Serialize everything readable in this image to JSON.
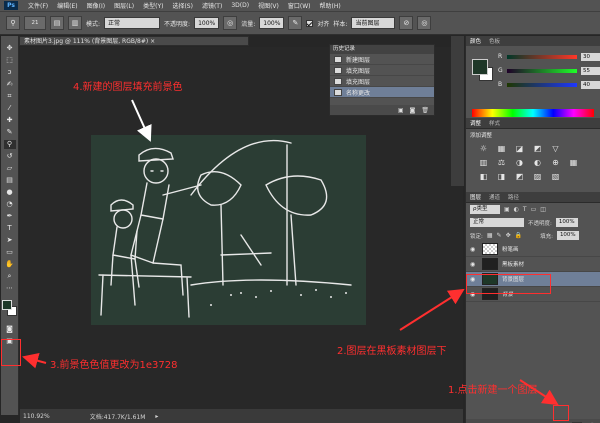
{
  "menubar": {
    "logo": "Ps",
    "items": [
      "文件(F)",
      "编辑(E)",
      "图像(I)",
      "图层(L)",
      "类型(Y)",
      "选择(S)",
      "滤镜(T)",
      "3D(D)",
      "视图(V)",
      "窗口(W)",
      "帮助(H)"
    ]
  },
  "options": {
    "brush_size": "21",
    "mode_label": "模式:",
    "mode_value": "正常",
    "opacity_label": "不透明度:",
    "opacity_value": "100%",
    "flow_label": "流量:",
    "flow_value": "100%",
    "align_label": "对齐",
    "sample_label": "样本:",
    "sample_value": "当前图层"
  },
  "document_tab": "素材图片3.jpg @ 111% (背景图层, RGB/8#) ×",
  "status": {
    "zoom": "110.92%",
    "doc": "文档:417.7K/1.61M"
  },
  "history": {
    "title": "历史记录",
    "items": [
      {
        "label": "新建图层",
        "selected": false
      },
      {
        "label": "填充图层",
        "selected": false
      },
      {
        "label": "填充图层",
        "selected": false
      },
      {
        "label": "名称更改",
        "selected": true
      }
    ]
  },
  "color_panel": {
    "tabs": [
      "颜色",
      "色板"
    ],
    "foreground": "#1e3728",
    "r_label": "R",
    "r_value": "30",
    "g_label": "G",
    "g_value": "55",
    "b_label": "B",
    "b_value": "40"
  },
  "adjust_panel": {
    "tabs": [
      "调整",
      "样式"
    ],
    "title": "添加调整",
    "icons": [
      "☼",
      "▦",
      "◪",
      "◩",
      "▽",
      "",
      "▥",
      "⚖",
      "◑",
      "◐",
      "⊕",
      "▦",
      "◧",
      "◨",
      "◩",
      "▨",
      "▧"
    ]
  },
  "layers_panel": {
    "tabs": [
      "图层",
      "通道",
      "路径"
    ],
    "kind": "ρ类型",
    "blend": "正常",
    "opacity_label": "不透明度:",
    "opacity": "100%",
    "lock_label": "锁定:",
    "fill_label": "填充:",
    "fill": "100%",
    "layers": [
      {
        "name": "粉笔画",
        "thumb": "checker",
        "selected": false,
        "italic": false
      },
      {
        "name": "黑板素材",
        "thumb": "dark",
        "selected": false,
        "italic": false
      },
      {
        "name": "背景图层",
        "thumb": "green",
        "selected": true,
        "italic": false
      },
      {
        "name": "背景",
        "thumb": "dark",
        "selected": false,
        "italic": true
      }
    ]
  },
  "annotations": {
    "a1": "1.点击新建一个图层",
    "a2": "2.图层在黑板素材图层下",
    "a3": "3.前景色色值更改为1e3728",
    "a4": "4.新建的图层填充前景色"
  }
}
